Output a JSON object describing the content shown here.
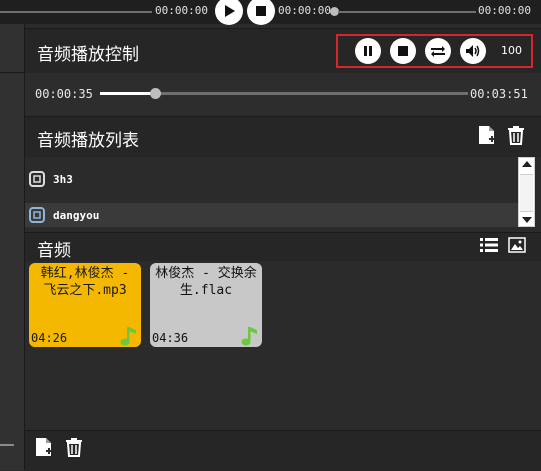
{
  "top_bar": {
    "time_left": "00:00:00",
    "time_mid": "00:00:00",
    "time_right": "00:00:00"
  },
  "control": {
    "title": "音频播放控制",
    "volume": "100",
    "icons": [
      "pause-icon",
      "stop-icon",
      "repeat-icon",
      "volume-icon"
    ]
  },
  "progress": {
    "current": "00:00:35",
    "total": "00:03:51",
    "fraction": 0.15
  },
  "playlist": {
    "title": "音频播放列表",
    "items": [
      {
        "label": "3h3",
        "selected": false
      },
      {
        "label": "dangyou",
        "selected": true
      }
    ]
  },
  "audio": {
    "title": "音频",
    "tiles": [
      {
        "title": "韩红,林俊杰 - 飞云之下.mp3",
        "duration": "04:26",
        "color": "#f5b800",
        "text_color": "#1a1a1a"
      },
      {
        "title": "林俊杰 - 交换余生.flac",
        "duration": "04:36",
        "color": "#c8c8c8",
        "text_color": "#111111"
      }
    ]
  },
  "colors": {
    "highlight_border": "#d6262b",
    "tile_playing": "#f5b800",
    "tile_idle": "#c8c8c8",
    "note_green": "#6cc83c"
  }
}
